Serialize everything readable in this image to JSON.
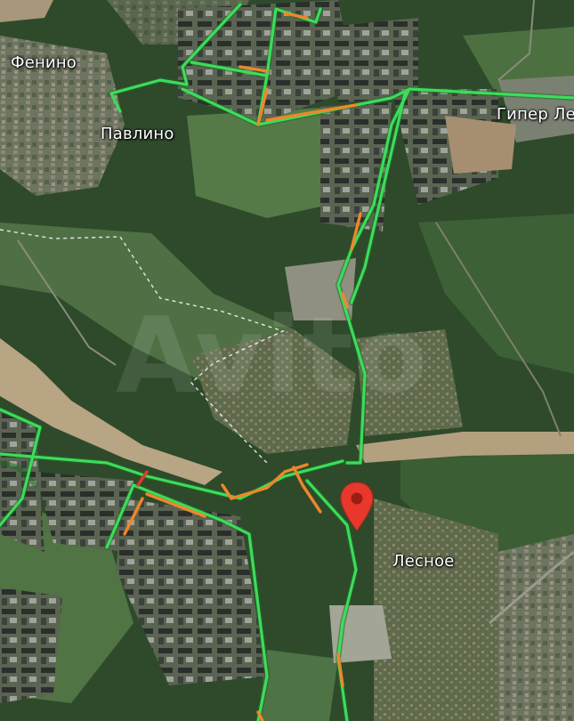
{
  "map": {
    "labels": {
      "fenino": "Фенино",
      "pavlino": "Павлино",
      "giper": "Гипер Ле",
      "lesnoe": "Лесное"
    },
    "watermark": "Avito",
    "traffic_colors": {
      "free": "#3ddc5a",
      "slow": "#f0862a",
      "jam": "#e03a2a"
    },
    "marker": {
      "icon": "map-pin-icon",
      "color": "#e8382b"
    }
  }
}
